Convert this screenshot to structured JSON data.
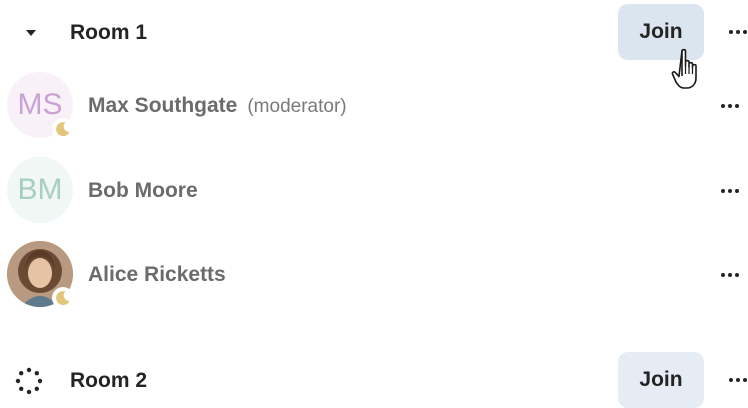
{
  "rooms": [
    {
      "name": "Room 1",
      "join_label": "Join",
      "expanded": true,
      "members": [
        {
          "initials": "MS",
          "name": "Max Southgate",
          "role": "(moderator)",
          "status": "away",
          "avatar_color": "#c9a3d6"
        },
        {
          "initials": "BM",
          "name": "Bob Moore",
          "role": "",
          "status": "",
          "avatar_color": "#a7cfc0"
        },
        {
          "initials": "",
          "name": "Alice Ricketts",
          "role": "",
          "status": "away",
          "avatar_type": "photo"
        }
      ]
    },
    {
      "name": "Room 2",
      "join_label": "Join",
      "expanded": false,
      "state": "loading"
    }
  ],
  "colors": {
    "text": "#242424",
    "muted_text": "#6b6b6b",
    "join_bg": "#e5ecf3",
    "join_bg_hover": "#dbe5ef",
    "away_moon": "#e3c67c"
  }
}
